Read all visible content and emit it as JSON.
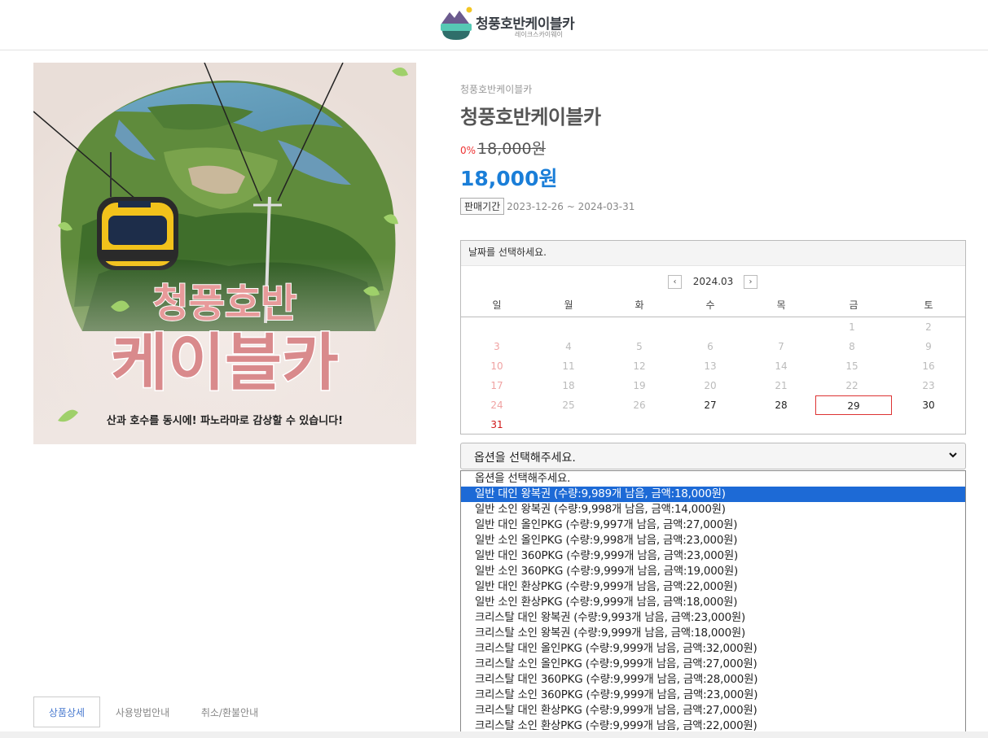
{
  "header": {
    "logo_title": "청풍호반케이블카",
    "logo_subtitle": "레이크스카이웨이"
  },
  "product_image": {
    "headline_1": "청풍호반",
    "headline_2": "케이블카",
    "caption": "산과 호수를 동시에! 파노라마로 감상할 수 있습니다!"
  },
  "product": {
    "brand": "청풍호반케이블카",
    "title": "청풍호반케이블카",
    "discount": "0%",
    "original_price": "18,000원",
    "sale_price": "18,000원",
    "period_label": "판매기간",
    "period_value": "2023-12-26 ~ 2024-03-31"
  },
  "calendar": {
    "header": "날짜를 선택하세요.",
    "month": "2024.03",
    "prev_icon": "chevron-left-icon",
    "next_icon": "chevron-right-icon",
    "weekdays": [
      "일",
      "월",
      "화",
      "수",
      "목",
      "금",
      "토"
    ],
    "weeks": [
      [
        {
          "d": ""
        },
        {
          "d": ""
        },
        {
          "d": ""
        },
        {
          "d": ""
        },
        {
          "d": ""
        },
        {
          "d": "1"
        },
        {
          "d": "2"
        }
      ],
      [
        {
          "d": "3"
        },
        {
          "d": "4"
        },
        {
          "d": "5"
        },
        {
          "d": "6"
        },
        {
          "d": "7"
        },
        {
          "d": "8"
        },
        {
          "d": "9"
        }
      ],
      [
        {
          "d": "10"
        },
        {
          "d": "11"
        },
        {
          "d": "12"
        },
        {
          "d": "13"
        },
        {
          "d": "14"
        },
        {
          "d": "15"
        },
        {
          "d": "16"
        }
      ],
      [
        {
          "d": "17"
        },
        {
          "d": "18"
        },
        {
          "d": "19"
        },
        {
          "d": "20"
        },
        {
          "d": "21"
        },
        {
          "d": "22"
        },
        {
          "d": "23"
        }
      ],
      [
        {
          "d": "24"
        },
        {
          "d": "25"
        },
        {
          "d": "26"
        },
        {
          "d": "27",
          "avail": true
        },
        {
          "d": "28",
          "avail": true
        },
        {
          "d": "29",
          "avail": true,
          "selected": true
        },
        {
          "d": "30",
          "avail": true
        }
      ],
      [
        {
          "d": "31",
          "avail": true
        },
        {
          "d": ""
        },
        {
          "d": ""
        },
        {
          "d": ""
        },
        {
          "d": ""
        },
        {
          "d": ""
        },
        {
          "d": ""
        }
      ]
    ],
    "selected_border_color": "#d33333",
    "sunday_color": "#d01818"
  },
  "option_select": {
    "value": "옵션을 선택해주세요.",
    "arrow_icon": "chevron-down-icon"
  },
  "option_list": {
    "highlight_color": "#1d6ad6",
    "options": [
      "옵션을 선택해주세요.",
      "일반 대인 왕복권 (수량:9,989개 남음, 금액:18,000원)",
      "일반 소인 왕복권 (수량:9,998개 남음, 금액:14,000원)",
      "일반 대인 올인PKG (수량:9,997개 남음, 금액:27,000원)",
      "일반 소인 올인PKG (수량:9,998개 남음, 금액:23,000원)",
      "일반 대인 360PKG (수량:9,999개 남음, 금액:23,000원)",
      "일반 소인 360PKG (수량:9,999개 남음, 금액:19,000원)",
      "일반 대인 환상PKG (수량:9,999개 남음, 금액:22,000원)",
      "일반 소인 환상PKG (수량:9,999개 남음, 금액:18,000원)",
      "크리스탈 대인 왕복권 (수량:9,993개 남음, 금액:23,000원)",
      "크리스탈 소인 왕복권 (수량:9,999개 남음, 금액:18,000원)",
      "크리스탈 대인 올인PKG (수량:9,999개 남음, 금액:32,000원)",
      "크리스탈 소인 올인PKG (수량:9,999개 남음, 금액:27,000원)",
      "크리스탈 대인 360PKG (수량:9,999개 남음, 금액:28,000원)",
      "크리스탈 소인 360PKG (수량:9,999개 남음, 금액:23,000원)",
      "크리스탈 대인 환상PKG (수량:9,999개 남음, 금액:27,000원)",
      "크리스탈 소인 환상PKG (수량:9,999개 남음, 금액:22,000원)"
    ],
    "highlighted_index": 1
  },
  "tabs": [
    {
      "label": "상품상세",
      "active": true
    },
    {
      "label": "사용방법안내",
      "active": false
    },
    {
      "label": "취소/환불안내",
      "active": false
    }
  ]
}
